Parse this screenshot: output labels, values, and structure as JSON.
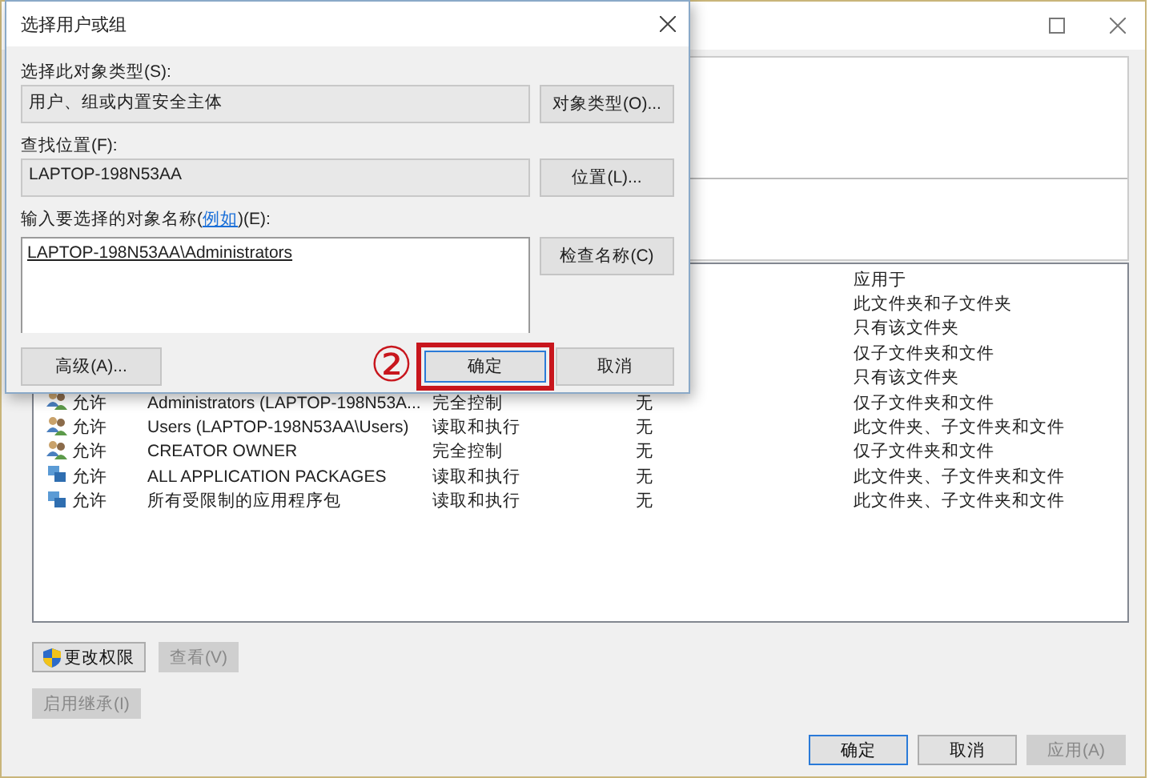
{
  "permissions": {
    "columns": {
      "applies_to": "应用于"
    },
    "rows": [
      {
        "applies_to": "此文件夹和子文件夹"
      },
      {
        "applies_to": "只有该文件夹"
      },
      {
        "applies_to": "仅子文件夹和文件"
      },
      {
        "applies_to": "只有该文件夹"
      },
      {
        "type": "允许",
        "principal": "Administrators (LAPTOP-198N53A...",
        "access": "完全控制",
        "inherited": "无",
        "applies_to": "仅子文件夹和文件",
        "kind": "group"
      },
      {
        "type": "允许",
        "principal": "Users (LAPTOP-198N53AA\\Users)",
        "access": "读取和执行",
        "inherited": "无",
        "applies_to": "此文件夹、子文件夹和文件",
        "kind": "group"
      },
      {
        "type": "允许",
        "principal": "CREATOR OWNER",
        "access": "完全控制",
        "inherited": "无",
        "applies_to": "仅子文件夹和文件",
        "kind": "group"
      },
      {
        "type": "允许",
        "principal": "ALL APPLICATION PACKAGES",
        "access": "读取和执行",
        "inherited": "无",
        "applies_to": "此文件夹、子文件夹和文件",
        "kind": "package"
      },
      {
        "type": "允许",
        "principal": "所有受限制的应用程序包",
        "access": "读取和执行",
        "inherited": "无",
        "applies_to": "此文件夹、子文件夹和文件",
        "kind": "package"
      }
    ]
  },
  "actions": [
    {
      "label": "更改权限",
      "disabled": false,
      "shield": true
    },
    {
      "label": "查看(V)",
      "disabled": true,
      "shield": false
    }
  ],
  "inheritance_button": {
    "label": "启用继承(I)",
    "disabled": true
  },
  "footer_buttons": [
    {
      "label": "确定",
      "disabled": false,
      "default": true
    },
    {
      "label": "取消",
      "disabled": false,
      "default": false
    },
    {
      "label": "应用(A)",
      "disabled": true,
      "default": false
    }
  ],
  "dialog": {
    "title": "选择用户或组",
    "object_type_label": "选择此对象类型(S):",
    "object_type_value": "用户、组或内置安全主体",
    "object_type_button": "对象类型(O)...",
    "location_label": "查找位置(F):",
    "location_value": "LAPTOP-198N53AA",
    "location_button": "位置(L)...",
    "names_label": {
      "before": "输入要选择的对象名称(",
      "link": "例如",
      "after": ")(E):"
    },
    "names_value": "LAPTOP-198N53AA\\Administrators",
    "check_button": "检查名称(C)",
    "advanced_button": "高级(A)...",
    "ok_button": "确定",
    "cancel_button": "取消",
    "annotation": "②"
  }
}
